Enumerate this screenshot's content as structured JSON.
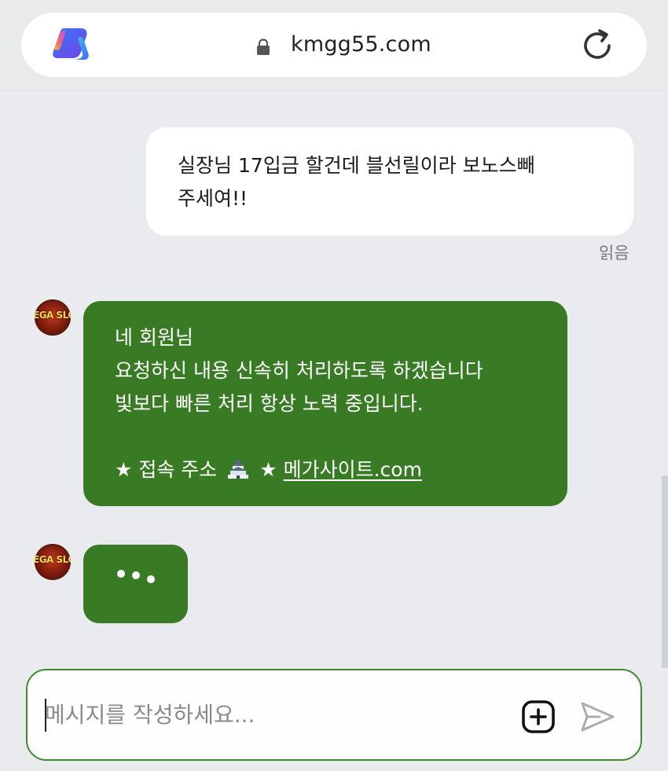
{
  "browser": {
    "url": "kmgg55.com",
    "icons": {
      "app": "copilot-icon",
      "secure": "lock-icon",
      "reload": "reload-icon"
    }
  },
  "chat": {
    "outgoing": {
      "lines": [
        "실장님 17입금 할건데 블선릴이라 보노스빼",
        "주세여!!"
      ],
      "status": "읽음"
    },
    "incoming": {
      "avatar_text": "EGA SLO",
      "lines": [
        "네 회원님",
        "요청하신 내용 신속히 처리하도록 하겠습니다",
        "빛보다 빠른 처리 항상 노력 중입니다."
      ],
      "address_prefix": "★ 접속 주소",
      "address_suffix": "★",
      "address_icon": "castle-icon",
      "address_link": "메가사이트.com"
    },
    "typing": {
      "avatar_text": "EGA SLO"
    }
  },
  "composer": {
    "placeholder": "메시지를 작성하세요...",
    "value": "",
    "icons": {
      "attach": "plus-square-icon",
      "send": "send-icon"
    }
  },
  "colors": {
    "bubble_in": "#397a24",
    "bubble_out": "#ffffff",
    "composer_border": "#3f8a2a",
    "background": "#e9ebee"
  }
}
